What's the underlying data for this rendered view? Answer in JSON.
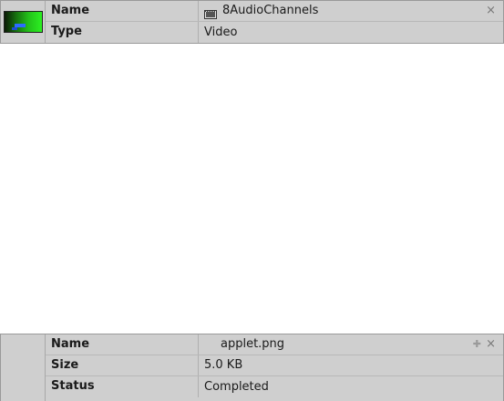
{
  "media_panel": {
    "rows": [
      {
        "label": "Name",
        "value": "8AudioChannels"
      },
      {
        "label": "Type",
        "value": "Video"
      }
    ],
    "icon": "film-icon",
    "close_symbol": "×"
  },
  "download_panel": {
    "rows": [
      {
        "label": "Name",
        "value": "applet.png"
      },
      {
        "label": "Size",
        "value": "5.0 KB"
      },
      {
        "label": "Status",
        "value": "Completed"
      }
    ],
    "pin_symbol": "✚",
    "close_symbol": "×"
  }
}
